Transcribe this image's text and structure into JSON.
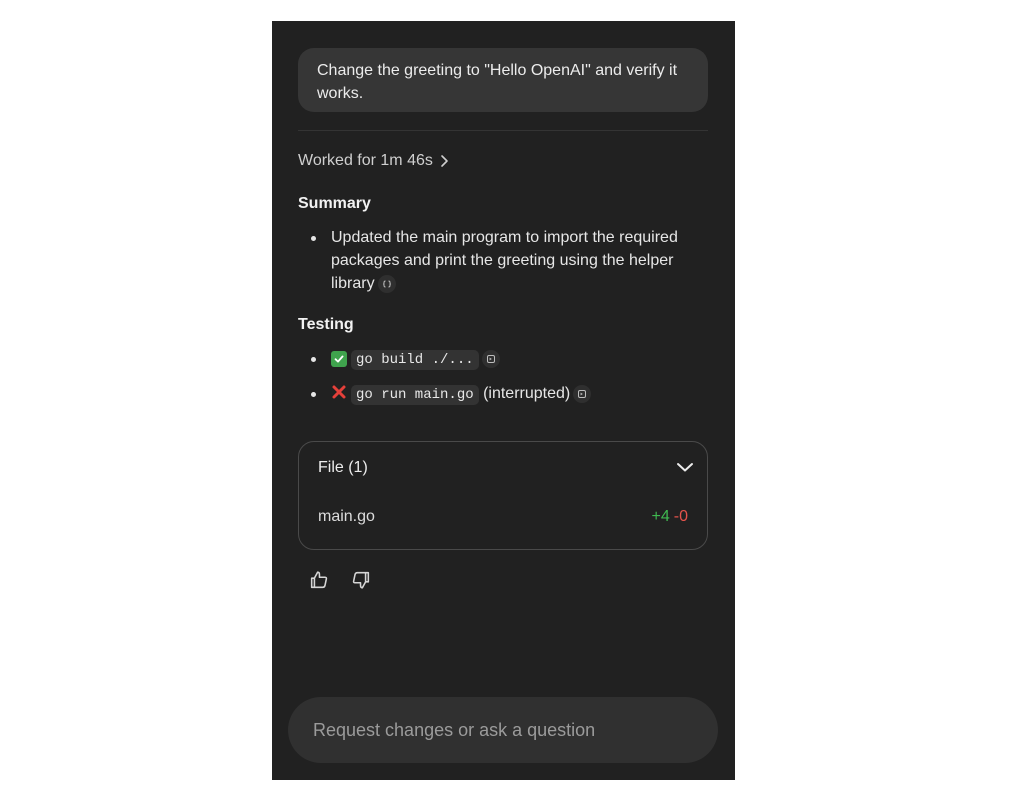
{
  "user_message": "Change the greeting to \"Hello OpenAI\" and verify it works.",
  "worked_for": "Worked for 1m 46s",
  "summary": {
    "title": "Summary",
    "items": [
      "Updated the main program to import the required packages and print the greeting using the helper library"
    ]
  },
  "testing": {
    "title": "Testing",
    "items": [
      {
        "status": "pass",
        "command": "go build ./...",
        "note": ""
      },
      {
        "status": "fail",
        "command": "go run main.go",
        "note": "(interrupted)"
      }
    ]
  },
  "files": {
    "header": "File (1)",
    "items": [
      {
        "name": "main.go",
        "additions": "+4",
        "deletions": "-0"
      }
    ]
  },
  "composer": {
    "placeholder": "Request changes or ask a question"
  },
  "colors": {
    "panel_bg": "#212121",
    "additions": "#3fb950",
    "deletions": "#e5534b",
    "pass": "#3fa34d"
  },
  "icons": [
    "chevron-right-icon",
    "code-icon",
    "terminal-icon",
    "check-icon",
    "cross-icon",
    "chevron-down-icon",
    "thumbs-up-icon",
    "thumbs-down-icon"
  ]
}
